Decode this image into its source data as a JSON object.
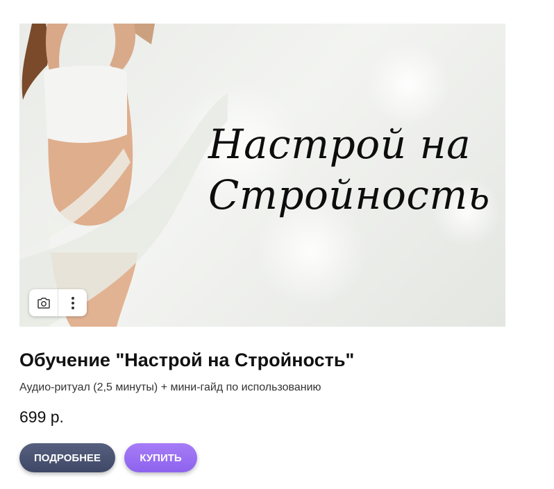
{
  "product": {
    "banner_text": "Настрой на Стройность",
    "title": "Обучение \"Настрой на Стройность\"",
    "description": "Аудио-ритуал (2,5 минуты) + мини-гайд по использованию",
    "price": "699 р."
  },
  "actions": {
    "more_label": "ПОДРОБНЕЕ",
    "buy_label": "КУПИТЬ"
  },
  "image_tools": {
    "lens_icon": "camera-search-icon",
    "menu_icon": "more-vertical-icon"
  },
  "colors": {
    "more_button": "#4a5372",
    "buy_button": "#9a70f3"
  }
}
